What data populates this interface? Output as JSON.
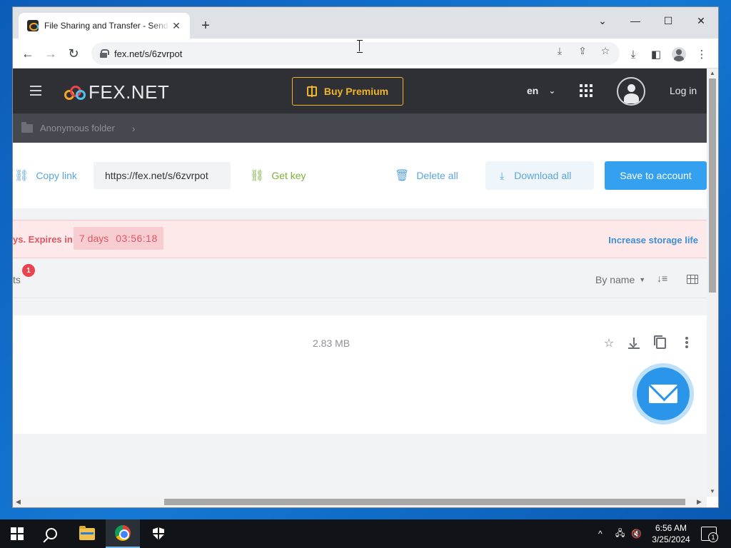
{
  "browser": {
    "tab_title": "File Sharing and Transfer - Send large files",
    "tab_close": "✕",
    "new_tab": "+",
    "url": "fex.net/s/6zvrpot",
    "window_controls": {
      "dropdown": "⌄",
      "minimize": "—",
      "maximize": "☐",
      "close": "✕"
    },
    "nav": {
      "back": "←",
      "forward": "→",
      "reload": "↻"
    }
  },
  "site": {
    "logo_text": "FEX.NET",
    "buy_premium": "Buy Premium",
    "language": "en",
    "login": "Log in",
    "breadcrumb": "Anonymous folder"
  },
  "actions": {
    "copy_link": "Copy link",
    "share_url": "https://fex.net/s/6zvrpot",
    "get_key": "Get key",
    "delete_all": "Delete all",
    "download_all": "Download all",
    "save_to_account": "Save to account"
  },
  "expiry": {
    "text": "ys. Expires in",
    "days": "7 days",
    "clock": "03:56:18",
    "increase": "Increase storage life"
  },
  "list": {
    "label": "ts",
    "badge": "1",
    "sort_label": "By name",
    "sort_caret": "▼",
    "sort_dir_icon": "↓≡"
  },
  "file": {
    "size": "2.83 MB"
  },
  "taskbar": {
    "time": "6:56 AM",
    "date": "3/25/2024",
    "notifications": "1"
  },
  "colors": {
    "header_bg": "#2e3035",
    "accent_blue": "#33a1f0",
    "premium_gold": "#f0b429",
    "expiry_red": "#e05660"
  }
}
